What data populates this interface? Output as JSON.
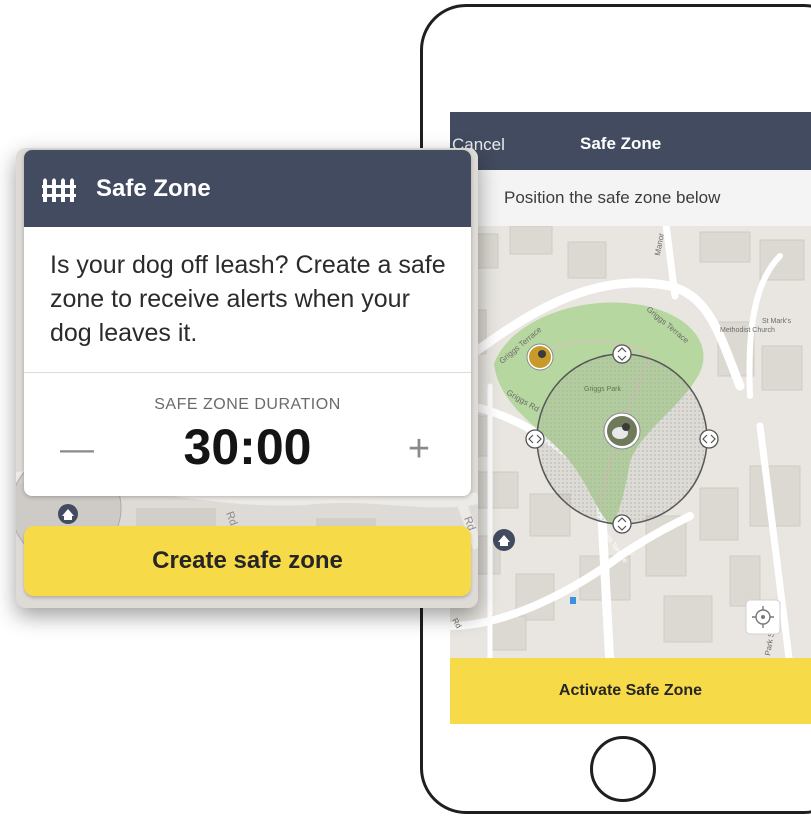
{
  "phone": {
    "navbar": {
      "cancel_label": "Cancel",
      "title": "Safe Zone"
    },
    "instruction": "Position the safe zone below",
    "map": {
      "street_labels": [
        "Griggs Terrace",
        "Griggs Terrace",
        "Griggs Rd",
        "Manor",
        "St Mark's",
        "Methodist Church",
        "Griggs Park",
        "St",
        "Park St",
        "Rd"
      ],
      "park_label": "Griggs Park"
    },
    "activate_label": "Activate Safe Zone"
  },
  "card": {
    "title": "Safe Zone",
    "body": "Is your dog off leash? Create a safe zone to receive alerts when your dog leaves it.",
    "duration_label": "SAFE ZONE DURATION",
    "duration_value": "30:00",
    "minus_symbol": "—",
    "plus_symbol": "+",
    "create_label": "Create safe zone",
    "bg_street_labels": [
      "Rd",
      "Rd"
    ]
  },
  "colors": {
    "header_navy": "#424b5f",
    "accent_yellow": "#f7da48",
    "park_green": "#b7d7a0",
    "map_base": "#e9e6e1"
  },
  "icons": {
    "fence": "fence-icon",
    "locate": "crosshair-icon",
    "handles": "chevron-icon",
    "dog_marker": "dog-avatar",
    "home": "home-pin-icon"
  }
}
